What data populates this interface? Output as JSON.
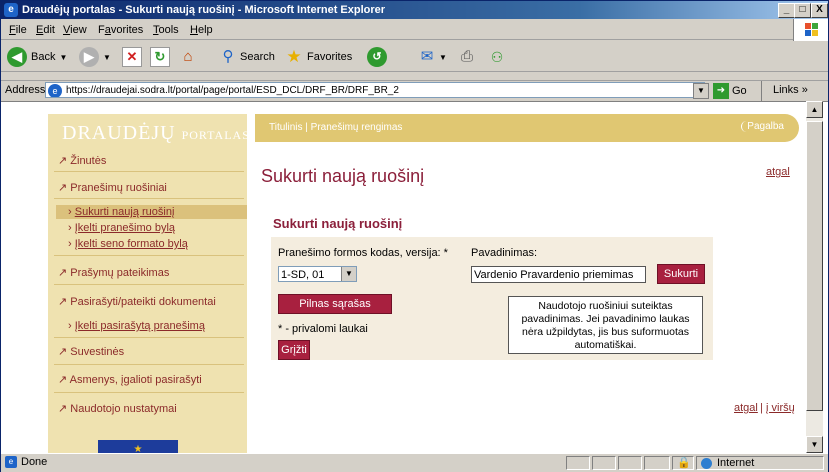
{
  "window": {
    "title": "Draudėjų portalas - Sukurti naują ruošinį - Microsoft Internet Explorer",
    "min": "_",
    "max": "□",
    "close": "X"
  },
  "menubar": {
    "items": [
      {
        "label": "File",
        "key": "F",
        "rest": "ile"
      },
      {
        "label": "Edit",
        "key": "E",
        "rest": "dit"
      },
      {
        "label": "View",
        "key": "V",
        "rest": "iew"
      },
      {
        "label": "Favorites",
        "key": "a",
        "pre": "F",
        "rest": "vorites"
      },
      {
        "label": "Tools",
        "key": "T",
        "rest": "ools"
      },
      {
        "label": "Help",
        "key": "H",
        "rest": "elp"
      }
    ]
  },
  "toolbar": {
    "back": "Back",
    "search": "Search",
    "favorites": "Favorites"
  },
  "address": {
    "label": "Address",
    "url": "https://draudejai.sodra.lt/portal/page/portal/ESD_DCL/DRF_BR/DRF_BR_2",
    "go": "Go",
    "links": "Links"
  },
  "sidebar": {
    "brand_main": "DRAUDĖJŲ",
    "brand_small": "PORTALAS",
    "items": [
      {
        "label": "Žinutės"
      },
      {
        "label": "Pranešimų ruošiniai"
      },
      {
        "label": "Sukurti naują ruošinį"
      },
      {
        "label": "Įkelti pranešimo bylą"
      },
      {
        "label": "Įkelti seno formato bylą"
      },
      {
        "label": "Prašymų pateikimas"
      },
      {
        "label": "Pasirašyti/pateikti dokumentai"
      },
      {
        "label": "Įkelti pasirašytą pranešimą"
      },
      {
        "label": "Suvestinės"
      },
      {
        "label": "Asmenys, įgalioti pasirašyti"
      },
      {
        "label": "Naudotojo nustatymai"
      }
    ],
    "bullet_main": "↗",
    "bullet_sub": "›"
  },
  "header": {
    "crumbs": "Titulinis | Pranešimų rengimas",
    "help": "Pagalba"
  },
  "main": {
    "title": "Sukurti naują ruošinį",
    "back_link": "atgal",
    "form_title": "Sukurti naują ruošinį",
    "code_label": "Pranešimo formos kodas, versija: *",
    "code_value": "1-SD, 01",
    "name_label": "Pavadinimas:",
    "name_value": "Vardenio Pravardenio priemimas",
    "create_button": "Sukurti",
    "list_button": "Pilnas sąrašas",
    "required_note": "* - privalomi laukai",
    "return_button": "Grįžti",
    "tooltip": "Naudotojo ruošiniui suteiktas pavadinimas. Jei pavadinimo laukas nėra užpildytas, jis bus suformuotas automatiškai.",
    "bottom_back": "atgal",
    "bottom_sep": "|",
    "bottom_top": "į viršų"
  },
  "status": {
    "text": "Done",
    "zone": "Internet"
  }
}
